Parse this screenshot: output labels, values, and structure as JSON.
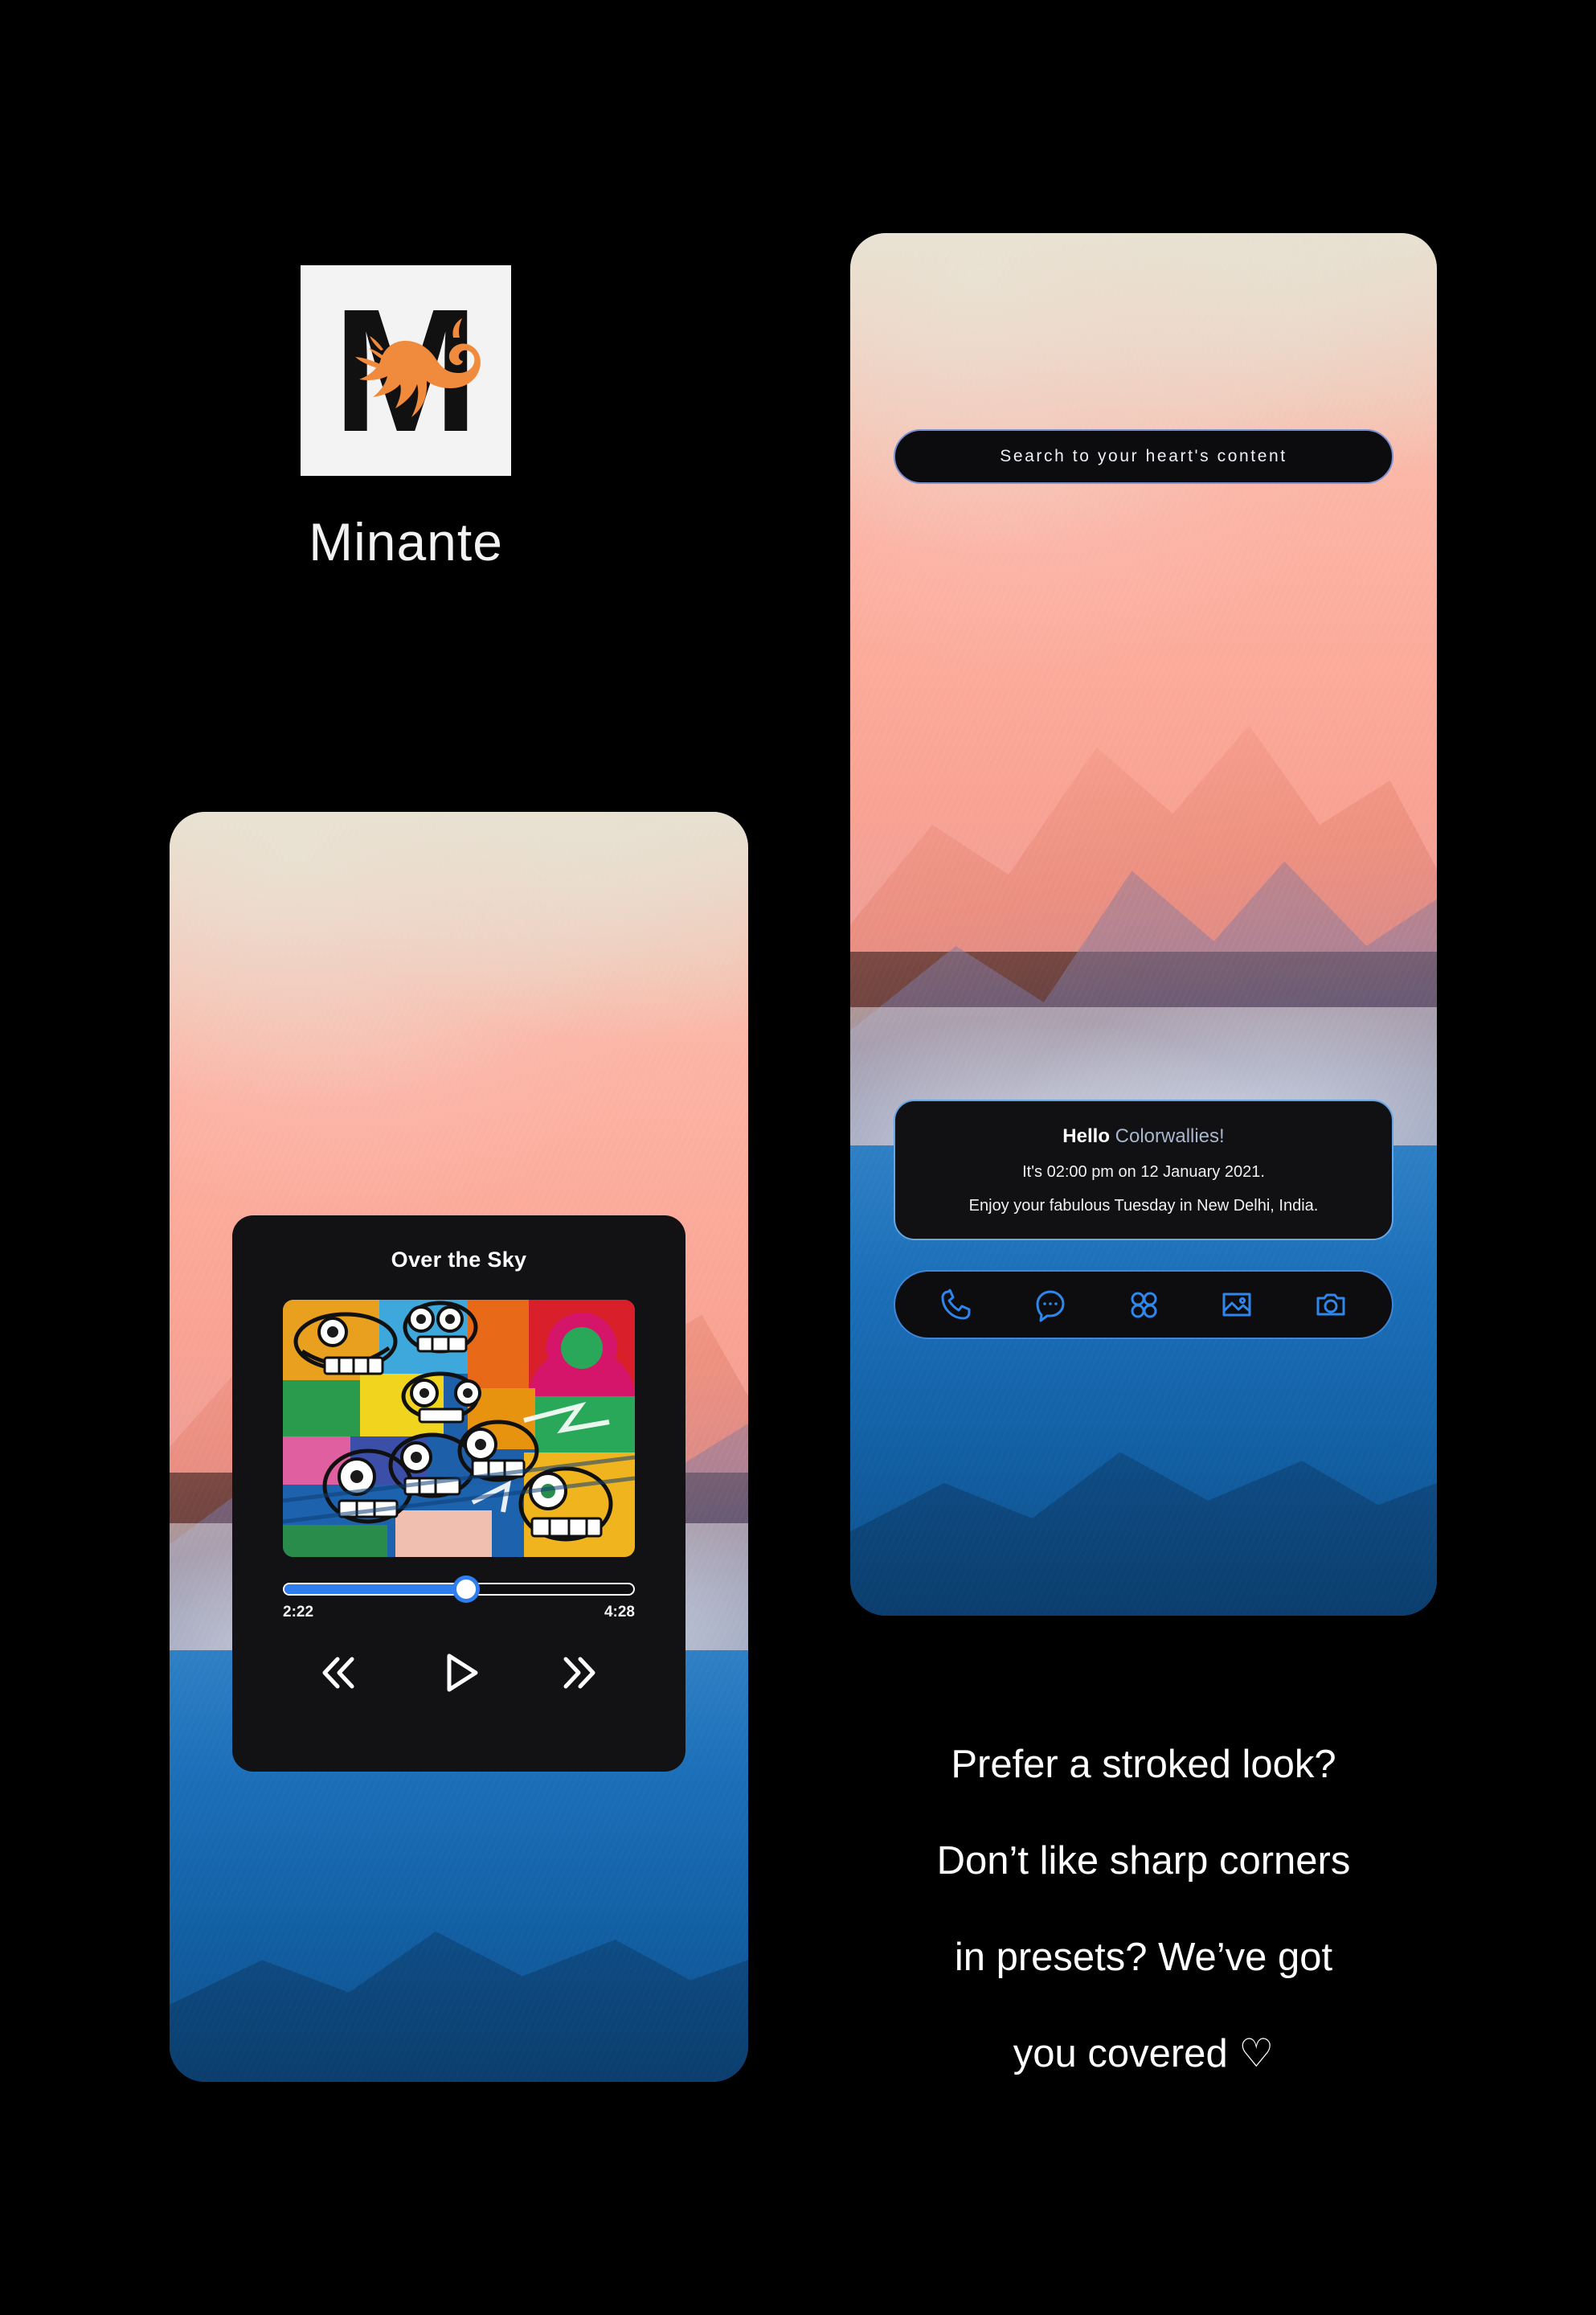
{
  "brand": {
    "logo_icon": "cat-on-letter-m-logo",
    "logo_letter": "M",
    "name": "Minante"
  },
  "phone_right": {
    "search": {
      "placeholder": "Search to your heart's content",
      "border_color": "#7b8fd4"
    },
    "greeting": {
      "hello": "Hello",
      "user": "Colorwallies!",
      "time_line": "It's 02:00 pm on 12 January 2021.",
      "enjoy_line": "Enjoy your fabulous Tuesday in New Delhi, India.",
      "user_color": "#a8b6cc",
      "border_color": "#63a6ea"
    },
    "dock": {
      "border_color": "#3f86d8",
      "icon_color": "#2f86ec",
      "items": [
        {
          "icon": "phone-icon",
          "label": "Phone"
        },
        {
          "icon": "chat-bubble-icon",
          "label": "Messages"
        },
        {
          "icon": "app-drawer-icon",
          "label": "Apps"
        },
        {
          "icon": "gallery-image-icon",
          "label": "Gallery"
        },
        {
          "icon": "camera-icon",
          "label": "Camera"
        }
      ]
    }
  },
  "phone_left": {
    "player": {
      "track_title": "Over the Sky",
      "album_art_icon": "graffiti-album-art",
      "progress_percent": 52,
      "elapsed": "2:22",
      "duration": "4:28",
      "fill_color": "#2f7ef0",
      "controls": [
        {
          "icon": "rewind-icon",
          "label": "Previous"
        },
        {
          "icon": "play-icon",
          "label": "Play"
        },
        {
          "icon": "fast-forward-icon",
          "label": "Next"
        }
      ]
    }
  },
  "tagline": {
    "lines": [
      "Prefer a stroked look?",
      "Don’t like sharp corners",
      "in presets? We’ve got",
      "you covered ♡"
    ]
  }
}
